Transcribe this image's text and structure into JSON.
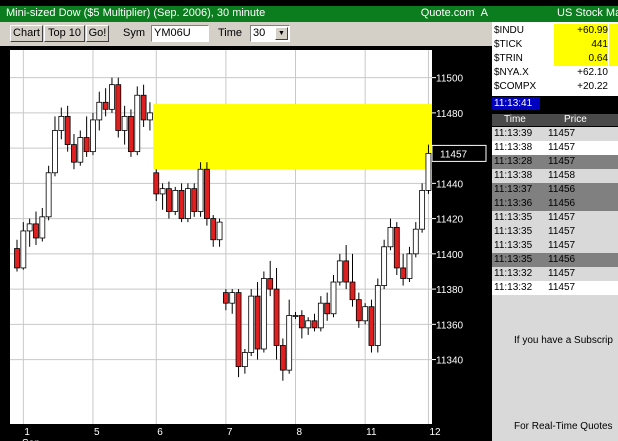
{
  "window": {
    "title": "Mini-sized Dow ($5 Multiplier) (Sep. 2006), 30 minute",
    "source": "Quote.com",
    "source_suffix": "A"
  },
  "toolbar": {
    "chart_label": "Chart",
    "top10_label": "Top 10",
    "go_label": "Go!",
    "sym_label": "Sym",
    "sym_value": "YM06U",
    "time_label": "Time",
    "time_value": "30"
  },
  "chart_data": {
    "type": "candlestick",
    "ylim": [
      11325,
      11510
    ],
    "yticks": [
      11340,
      11360,
      11380,
      11400,
      11420,
      11440,
      11460,
      11480,
      11500
    ],
    "ytick_labels": [
      "11340",
      "11360",
      "11380",
      "11400",
      "11420",
      "11440",
      "11460",
      "11480",
      "11500"
    ],
    "xtick_labels": [
      {
        "label": "1",
        "idx": 1
      },
      {
        "label": "5",
        "idx": 12
      },
      {
        "label": "6",
        "idx": 22
      },
      {
        "label": "7",
        "idx": 33
      },
      {
        "label": "8",
        "idx": 44
      },
      {
        "label": "11",
        "idx": 55
      },
      {
        "label": "12",
        "idx": 65
      }
    ],
    "month_label": "Sep",
    "last_price_label": "11457",
    "last_price": 11457,
    "highlight_band": {
      "x_start_idx": 22,
      "y_low": 11448,
      "y_high": 11485,
      "color": "#ffff00"
    },
    "up_color": "#ffffff",
    "down_color": "#e02020",
    "bars": [
      {
        "o": 11403,
        "h": 11408,
        "l": 11390,
        "c": 11392
      },
      {
        "o": 11392,
        "h": 11418,
        "l": 11391,
        "c": 11413
      },
      {
        "o": 11413,
        "h": 11420,
        "l": 11404,
        "c": 11417
      },
      {
        "o": 11417,
        "h": 11424,
        "l": 11405,
        "c": 11409
      },
      {
        "o": 11409,
        "h": 11426,
        "l": 11407,
        "c": 11421
      },
      {
        "o": 11421,
        "h": 11450,
        "l": 11419,
        "c": 11446
      },
      {
        "o": 11446,
        "h": 11478,
        "l": 11444,
        "c": 11470
      },
      {
        "o": 11470,
        "h": 11483,
        "l": 11465,
        "c": 11478
      },
      {
        "o": 11478,
        "h": 11484,
        "l": 11458,
        "c": 11462
      },
      {
        "o": 11462,
        "h": 11468,
        "l": 11448,
        "c": 11452
      },
      {
        "o": 11452,
        "h": 11470,
        "l": 11450,
        "c": 11466
      },
      {
        "o": 11466,
        "h": 11478,
        "l": 11455,
        "c": 11458
      },
      {
        "o": 11458,
        "h": 11480,
        "l": 11456,
        "c": 11476
      },
      {
        "o": 11476,
        "h": 11492,
        "l": 11470,
        "c": 11486
      },
      {
        "o": 11486,
        "h": 11494,
        "l": 11478,
        "c": 11482
      },
      {
        "o": 11482,
        "h": 11500,
        "l": 11480,
        "c": 11496
      },
      {
        "o": 11496,
        "h": 11500,
        "l": 11466,
        "c": 11470
      },
      {
        "o": 11470,
        "h": 11484,
        "l": 11462,
        "c": 11478
      },
      {
        "o": 11478,
        "h": 11482,
        "l": 11455,
        "c": 11458
      },
      {
        "o": 11458,
        "h": 11495,
        "l": 11456,
        "c": 11490
      },
      {
        "o": 11490,
        "h": 11496,
        "l": 11472,
        "c": 11476
      },
      {
        "o": 11476,
        "h": 11486,
        "l": 11470,
        "c": 11480
      },
      {
        "o": 11446,
        "h": 11448,
        "l": 11430,
        "c": 11434
      },
      {
        "o": 11434,
        "h": 11440,
        "l": 11425,
        "c": 11437
      },
      {
        "o": 11437,
        "h": 11441,
        "l": 11420,
        "c": 11424
      },
      {
        "o": 11424,
        "h": 11438,
        "l": 11422,
        "c": 11436
      },
      {
        "o": 11436,
        "h": 11440,
        "l": 11418,
        "c": 11420
      },
      {
        "o": 11420,
        "h": 11440,
        "l": 11418,
        "c": 11437
      },
      {
        "o": 11437,
        "h": 11440,
        "l": 11421,
        "c": 11424
      },
      {
        "o": 11424,
        "h": 11452,
        "l": 11421,
        "c": 11448
      },
      {
        "o": 11448,
        "h": 11452,
        "l": 11416,
        "c": 11420
      },
      {
        "o": 11420,
        "h": 11422,
        "l": 11404,
        "c": 11408
      },
      {
        "o": 11408,
        "h": 11420,
        "l": 11404,
        "c": 11418
      },
      {
        "o": 11378,
        "h": 11380,
        "l": 11368,
        "c": 11372
      },
      {
        "o": 11372,
        "h": 11380,
        "l": 11366,
        "c": 11378
      },
      {
        "o": 11378,
        "h": 11380,
        "l": 11330,
        "c": 11336
      },
      {
        "o": 11336,
        "h": 11346,
        "l": 11332,
        "c": 11344
      },
      {
        "o": 11344,
        "h": 11380,
        "l": 11342,
        "c": 11376
      },
      {
        "o": 11376,
        "h": 11384,
        "l": 11340,
        "c": 11346
      },
      {
        "o": 11346,
        "h": 11390,
        "l": 11344,
        "c": 11386
      },
      {
        "o": 11386,
        "h": 11396,
        "l": 11376,
        "c": 11380
      },
      {
        "o": 11380,
        "h": 11392,
        "l": 11340,
        "c": 11348
      },
      {
        "o": 11348,
        "h": 11352,
        "l": 11328,
        "c": 11334
      },
      {
        "o": 11334,
        "h": 11374,
        "l": 11332,
        "c": 11365
      },
      {
        "o": 11365,
        "h": 11367,
        "l": 11363,
        "c": 11365
      },
      {
        "o": 11365,
        "h": 11368,
        "l": 11352,
        "c": 11358
      },
      {
        "o": 11358,
        "h": 11364,
        "l": 11354,
        "c": 11362
      },
      {
        "o": 11362,
        "h": 11366,
        "l": 11356,
        "c": 11358
      },
      {
        "o": 11358,
        "h": 11376,
        "l": 11356,
        "c": 11372
      },
      {
        "o": 11372,
        "h": 11378,
        "l": 11362,
        "c": 11366
      },
      {
        "o": 11366,
        "h": 11388,
        "l": 11364,
        "c": 11384
      },
      {
        "o": 11384,
        "h": 11400,
        "l": 11382,
        "c": 11396
      },
      {
        "o": 11396,
        "h": 11405,
        "l": 11380,
        "c": 11384
      },
      {
        "o": 11384,
        "h": 11400,
        "l": 11370,
        "c": 11374
      },
      {
        "o": 11374,
        "h": 11378,
        "l": 11358,
        "c": 11362
      },
      {
        "o": 11362,
        "h": 11372,
        "l": 11360,
        "c": 11370
      },
      {
        "o": 11370,
        "h": 11374,
        "l": 11344,
        "c": 11348
      },
      {
        "o": 11348,
        "h": 11386,
        "l": 11344,
        "c": 11382
      },
      {
        "o": 11382,
        "h": 11408,
        "l": 11380,
        "c": 11404
      },
      {
        "o": 11404,
        "h": 11420,
        "l": 11402,
        "c": 11415
      },
      {
        "o": 11415,
        "h": 11418,
        "l": 11388,
        "c": 11392
      },
      {
        "o": 11392,
        "h": 11400,
        "l": 11382,
        "c": 11386
      },
      {
        "o": 11386,
        "h": 11404,
        "l": 11384,
        "c": 11400
      },
      {
        "o": 11400,
        "h": 11418,
        "l": 11398,
        "c": 11414
      },
      {
        "o": 11414,
        "h": 11440,
        "l": 11412,
        "c": 11436
      },
      {
        "o": 11436,
        "h": 11462,
        "l": 11434,
        "c": 11457
      }
    ]
  },
  "market": {
    "title": "US Stock Ma",
    "items": [
      {
        "name": "$INDU",
        "value": "+60.99",
        "highlight": true
      },
      {
        "name": "$TICK",
        "value": "441",
        "highlight": true
      },
      {
        "name": "$TRIN",
        "value": "0.64",
        "highlight": true
      },
      {
        "name": "$NYA.X",
        "value": "+62.10",
        "highlight": false
      },
      {
        "name": "$COMPX",
        "value": "+20.22",
        "highlight": false
      }
    ]
  },
  "clock": "11:13:41",
  "time_sales": {
    "time_header": "Time",
    "price_header": "Price",
    "rows": [
      {
        "time": "11:13:39",
        "price": "11457",
        "bg": "#d9d9d9"
      },
      {
        "time": "11:13:38",
        "price": "11457",
        "bg": "#ffffff"
      },
      {
        "time": "11:13:28",
        "price": "11457",
        "bg": "#808080"
      },
      {
        "time": "11:13:38",
        "price": "11458",
        "bg": "#d9d9d9"
      },
      {
        "time": "11:13:37",
        "price": "11456",
        "bg": "#808080"
      },
      {
        "time": "11:13:36",
        "price": "11456",
        "bg": "#808080"
      },
      {
        "time": "11:13:35",
        "price": "11457",
        "bg": "#d9d9d9"
      },
      {
        "time": "11:13:35",
        "price": "11457",
        "bg": "#d9d9d9"
      },
      {
        "time": "11:13:35",
        "price": "11457",
        "bg": "#d9d9d9"
      },
      {
        "time": "11:13:35",
        "price": "11456",
        "bg": "#808080"
      },
      {
        "time": "11:13:32",
        "price": "11457",
        "bg": "#d9d9d9"
      },
      {
        "time": "11:13:32",
        "price": "11457",
        "bg": "#ffffff"
      }
    ]
  },
  "info": {
    "line1": "If you have a Subscrip",
    "line2": "For Real-Time Quotes"
  }
}
